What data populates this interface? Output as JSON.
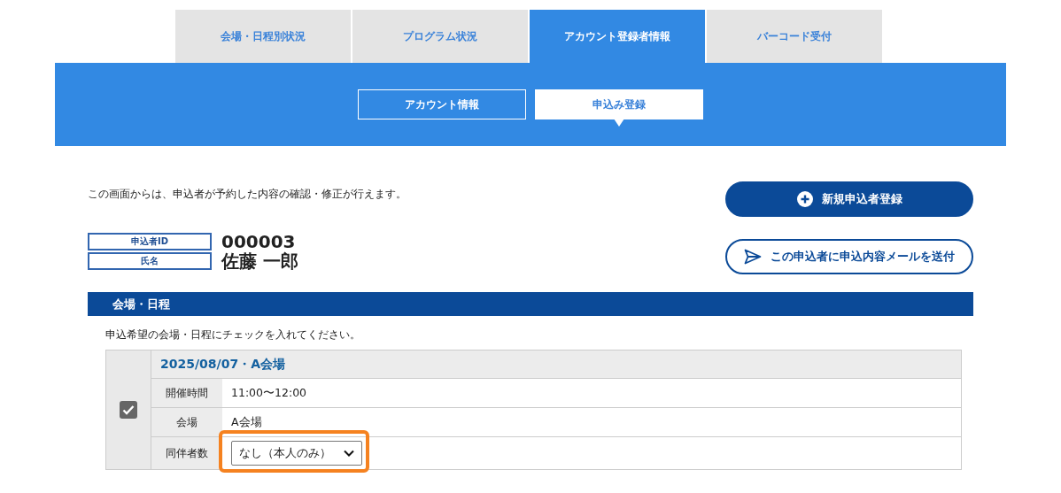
{
  "tabs": [
    {
      "label": "会場・日程別状況",
      "selected": false
    },
    {
      "label": "プログラム状況",
      "selected": false
    },
    {
      "label": "アカウント登録者情報",
      "selected": true
    },
    {
      "label": "バーコード受付",
      "selected": false
    }
  ],
  "subtabs": [
    {
      "label": "アカウント情報",
      "selected": false
    },
    {
      "label": "申込み登録",
      "selected": true
    }
  ],
  "intro": "この画面からは、申込者が予約した内容の確認・修正が行えます。",
  "applicant": [
    {
      "label": "申込者ID",
      "value": "000003"
    },
    {
      "label": "氏名",
      "value": "佐藤 一郎"
    }
  ],
  "buttons": [
    {
      "kind": "primary",
      "label": "新規申込者登録"
    },
    {
      "kind": "outline",
      "label": "この申込者に申込内容メールを送付"
    }
  ],
  "section": {
    "title": "会場・日程",
    "instruction": "申込希望の会場・日程にチェックを入れてください。",
    "entries": [
      {
        "checked": true,
        "title": "2025/08/07・A会場",
        "rows": [
          {
            "kind": "text",
            "label": "開催時間",
            "value": "11:00〜12:00"
          },
          {
            "kind": "text",
            "label": "会場",
            "value": "A会場"
          },
          {
            "kind": "select",
            "label": "同伴者数",
            "value": "なし（本人のみ）",
            "highlighted": true
          }
        ]
      }
    ]
  }
}
